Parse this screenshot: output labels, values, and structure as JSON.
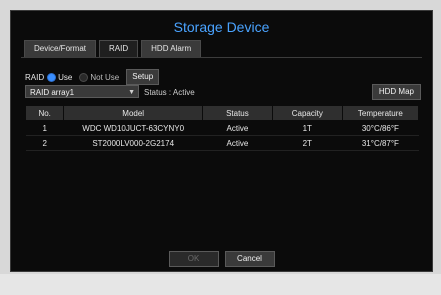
{
  "window": {
    "title": "Storage Device"
  },
  "tabs": [
    {
      "label": "Device/Format",
      "active": false
    },
    {
      "label": "RAID",
      "active": true
    },
    {
      "label": "HDD Alarm",
      "active": false
    }
  ],
  "raid": {
    "label": "RAID",
    "use_label": "Use",
    "not_use_label": "Not Use",
    "selected": "Use",
    "setup_label": "Setup"
  },
  "array": {
    "selected": "RAID array1",
    "status_text": "Status : Active",
    "hdd_map_label": "HDD Map"
  },
  "table": {
    "headers": [
      "No.",
      "Model",
      "Status",
      "Capacity",
      "Temperature"
    ],
    "rows": [
      [
        "1",
        "WDC WD10JUCT-63CYNY0",
        "Active",
        "1T",
        "30°C/86°F"
      ],
      [
        "2",
        "ST2000LV000-2G2174",
        "Active",
        "2T",
        "31°C/87°F"
      ]
    ]
  },
  "footer": {
    "ok_label": "OK",
    "cancel_label": "Cancel"
  },
  "colors": {
    "accent": "#4aa3ff",
    "background": "#0b0b0b"
  }
}
